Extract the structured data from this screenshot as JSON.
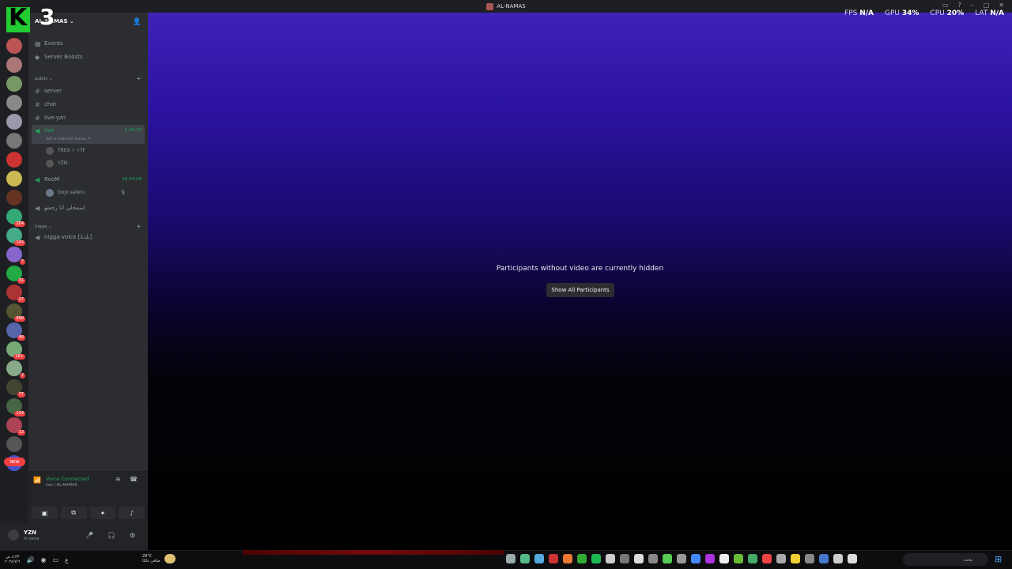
{
  "window": {
    "title": "AL-NAMAS"
  },
  "overlay": {
    "logo_letter": "K",
    "logo_number": "3"
  },
  "perf": [
    {
      "label": "FPS",
      "value": "N/A"
    },
    {
      "label": "GPU",
      "value": "34%"
    },
    {
      "label": "CPU",
      "value": "20%"
    },
    {
      "label": "LAT",
      "value": "N/A"
    }
  ],
  "server": {
    "name": "AL-NAMAS"
  },
  "sidebar": {
    "events": "Events",
    "boosts": "Server Boosts",
    "category_public": "public",
    "category_nigga": "nigga",
    "channels": {
      "server": "server",
      "chat": "chat",
      "live_yzn": "live-yzn",
      "live": "live",
      "live_status": "Set a channel status",
      "live_timer": "1:05:10",
      "room": "RooM",
      "room_timer": "16:24:09",
      "arabic": "اسمحلي انا رجعتو",
      "nigga_voice": "nigga-voice [بلدنا]"
    },
    "live_users": [
      "TREX ⚡ ⚡TF",
      "YZN"
    ],
    "room_users": [
      "Gojo sateru"
    ]
  },
  "server_badges": [
    "",
    "",
    "",
    "",
    "",
    "",
    "",
    "",
    "",
    "204",
    "145",
    "7",
    "31",
    "27",
    "898",
    "48",
    "1K+",
    "2",
    "77",
    "124",
    "13",
    "",
    ""
  ],
  "new_label": "NEW",
  "voice": {
    "title": "Voice Connected",
    "sub": "live / AL-NAMAS"
  },
  "user": {
    "name": "YZN",
    "status": "In voice"
  },
  "stage": {
    "message": "Participants without video are currently hidden",
    "button": "Show All Participants"
  },
  "taskbar": {
    "clock_line1": "٤:٣٣ ص",
    "clock_line2": "٢٠٢٤/٧/٦",
    "weather_temp": "28°C",
    "weather_desc": "صافي غالبًا",
    "search_placeholder": "بحث"
  }
}
